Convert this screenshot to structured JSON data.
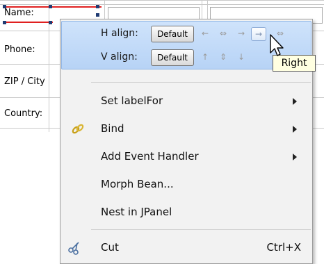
{
  "form": {
    "labels": [
      "Name:",
      "Phone:",
      "ZIP / City",
      "Country:"
    ]
  },
  "menu": {
    "h_align_label": "H align:",
    "v_align_label": "V align:",
    "default_label": "Default",
    "items": [
      {
        "label": "Set labelFor",
        "submenu": true
      },
      {
        "label": "Bind",
        "submenu": true,
        "icon": "bind-chain-icon"
      },
      {
        "label": "Add Event Handler",
        "submenu": true
      },
      {
        "label": "Morph Bean...",
        "submenu": false
      },
      {
        "label": "Nest in JPanel",
        "submenu": false
      },
      {
        "label": "Cut",
        "submenu": false,
        "shortcut": "Ctrl+X",
        "icon": "scissors-icon"
      }
    ]
  },
  "tooltip": "Right",
  "colors": {
    "highlight": "#b7d3f6",
    "selection_red": "#e02020",
    "tooltip_bg": "#ffffe1"
  }
}
